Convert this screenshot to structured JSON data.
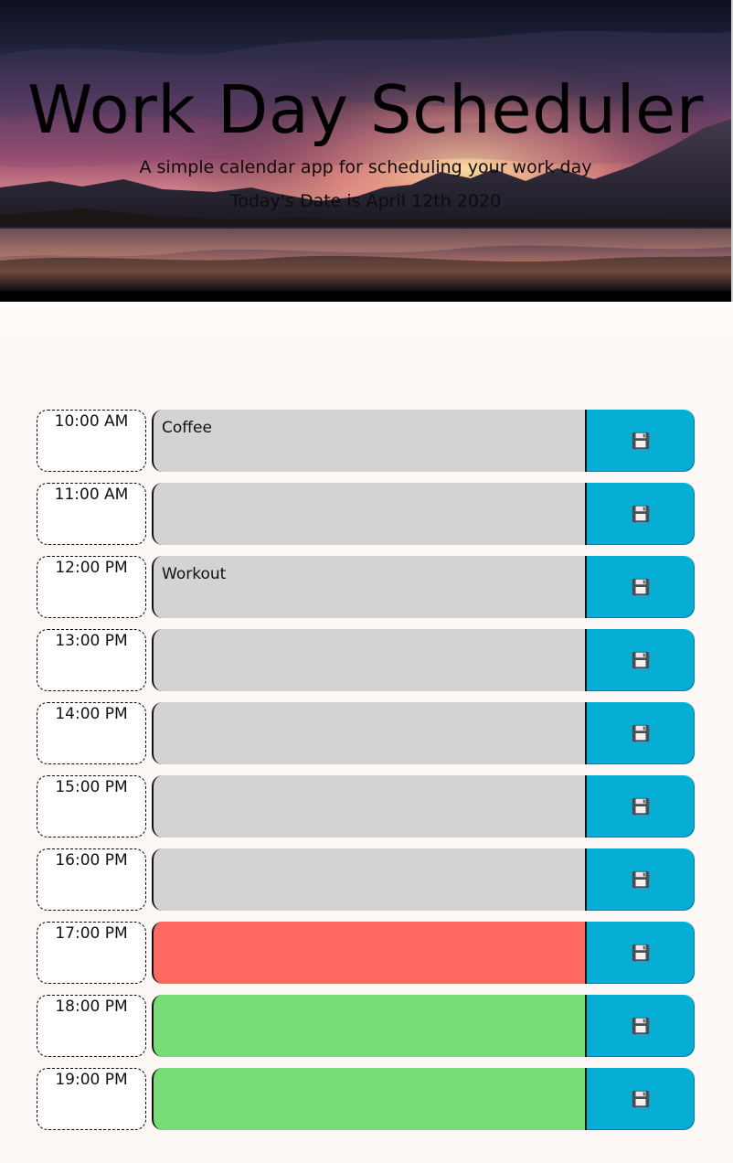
{
  "header": {
    "title": "Work Day Scheduler",
    "subtitle": "A simple calendar app for scheduling your work day",
    "date_text": "Today's Date is April 12th 2020"
  },
  "colors": {
    "past": "#d3d3d3",
    "present": "#ff6961",
    "future": "#77dd77",
    "save_button": "#06aed5"
  },
  "schedule": [
    {
      "hour": "10:00 AM",
      "text": "Coffee",
      "status": "past"
    },
    {
      "hour": "11:00 AM",
      "text": "",
      "status": "past"
    },
    {
      "hour": "12:00 PM",
      "text": "Workout",
      "status": "past"
    },
    {
      "hour": "13:00 PM",
      "text": "",
      "status": "past"
    },
    {
      "hour": "14:00 PM",
      "text": "",
      "status": "past"
    },
    {
      "hour": "15:00 PM",
      "text": "",
      "status": "past"
    },
    {
      "hour": "16:00 PM",
      "text": "",
      "status": "past"
    },
    {
      "hour": "17:00 PM",
      "text": "",
      "status": "present"
    },
    {
      "hour": "18:00 PM",
      "text": "",
      "status": "future"
    },
    {
      "hour": "19:00 PM",
      "text": "",
      "status": "future"
    }
  ],
  "icons": {
    "save": "floppy-disk-icon"
  }
}
